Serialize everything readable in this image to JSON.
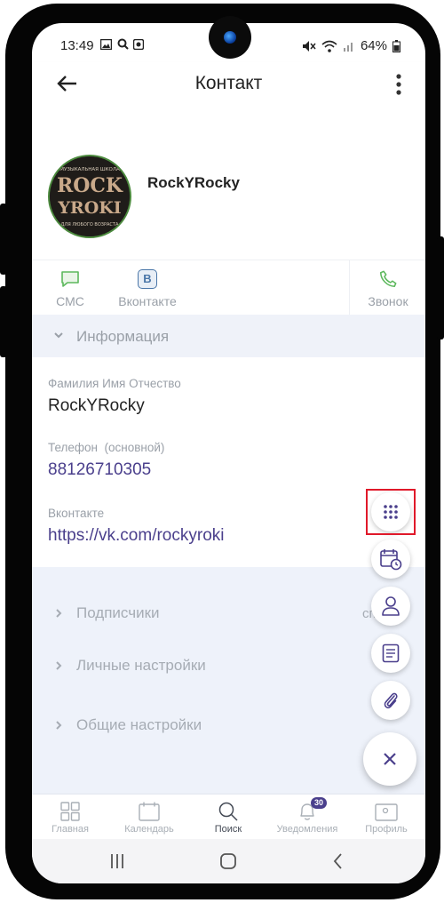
{
  "status_bar": {
    "time": "13:49",
    "battery": "64%",
    "left_icons": [
      "image-icon",
      "search-icon",
      "record-icon"
    ],
    "right_icons": [
      "mute-icon",
      "wifi-icon",
      "signal-icon",
      "battery-icon"
    ]
  },
  "header": {
    "title": "Контакт",
    "back_icon": "arrow-left-icon",
    "menu_icon": "more-vertical-icon"
  },
  "contact": {
    "name": "RockYRocky",
    "avatar_logo": {
      "top": "МУЗЫКАЛЬНАЯ ШКОЛА",
      "line1": "ROCK",
      "line2": "YROKI",
      "bottom": "ДЛЯ ЛЮБОГО ВОЗРАСТА"
    }
  },
  "actions": {
    "sms": "СМС",
    "vk": "Вконтакте",
    "vk_icon_letter": "В",
    "call": "Звонок"
  },
  "info_section": {
    "title": "Информация",
    "fields": [
      {
        "label": "Фамилия Имя Отчество",
        "value": "RockYRocky"
      },
      {
        "label": "Телефон  (основной)",
        "value": "88126710305"
      },
      {
        "label": "Вконтакте",
        "value": "https://vk.com/rockyroki"
      }
    ]
  },
  "groups": {
    "subscribers": "Подписчики",
    "subscribers_cut": "сп",
    "personal_settings": "Личные настройки",
    "general_settings": "Общие настройки"
  },
  "fab_menu": {
    "items": [
      "keypad-icon",
      "calendar-clock-icon",
      "user-icon",
      "note-icon",
      "paperclip-icon"
    ],
    "close_icon": "close-icon"
  },
  "bottom_nav": {
    "items": [
      {
        "label": "Главная",
        "icon": "grid-icon",
        "active": false
      },
      {
        "label": "Календарь",
        "icon": "calendar-icon",
        "active": false
      },
      {
        "label": "Поиск",
        "icon": "search-icon",
        "active": true
      },
      {
        "label": "Уведомления",
        "icon": "bell-icon",
        "active": false,
        "badge": "30"
      },
      {
        "label": "Профиль",
        "icon": "profile-card-icon",
        "active": false
      }
    ]
  },
  "colors": {
    "accent": "#4a3f8c",
    "section_bg": "#eff2f9",
    "sms_green": "#5cb85c",
    "vk_blue": "#4a76a8",
    "highlight_red": "#e0192a"
  }
}
